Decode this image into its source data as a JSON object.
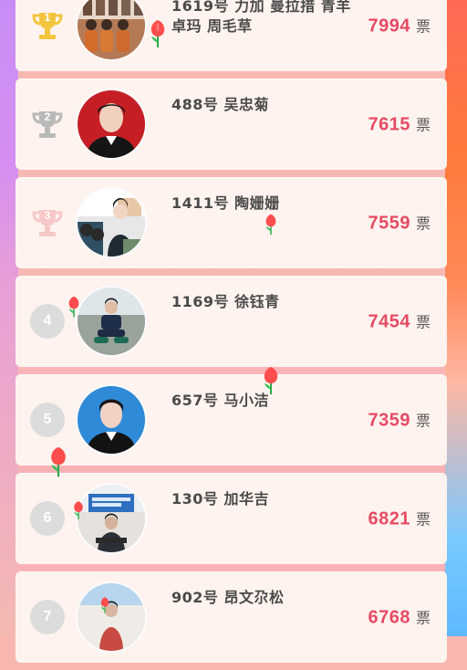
{
  "vote_unit": "票",
  "items": [
    {
      "rank": "1",
      "name": "1619号 力加 曼拉措 青羊卓玛 周毛草",
      "votes": "7994",
      "rank_icon": "gold-trophy-icon"
    },
    {
      "rank": "2",
      "name": "488号 吴忠菊",
      "votes": "7615",
      "rank_icon": "silver-trophy-icon"
    },
    {
      "rank": "3",
      "name": "1411号 陶姗姗",
      "votes": "7559",
      "rank_icon": "bronze-trophy-icon"
    },
    {
      "rank": "4",
      "name": "1169号 徐钰青",
      "votes": "7454",
      "rank_icon": "rank-circle"
    },
    {
      "rank": "5",
      "name": "657号 马小洁",
      "votes": "7359",
      "rank_icon": "rank-circle"
    },
    {
      "rank": "6",
      "name": "130号 加华吉",
      "votes": "6821",
      "rank_icon": "rank-circle"
    },
    {
      "rank": "7",
      "name": "902号 昂文尕松",
      "votes": "6768",
      "rank_icon": "rank-circle"
    }
  ],
  "colors": {
    "gold": "#f3c53f",
    "silver": "#b9b9b9",
    "bronze": "#f6c8c8",
    "vote_count": "#e64a63"
  }
}
